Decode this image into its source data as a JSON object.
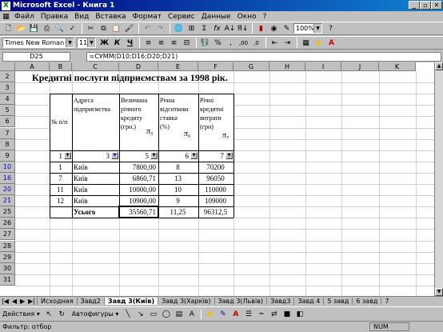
{
  "window": {
    "title": "Microsoft Excel - Книга 1",
    "minimize": "_",
    "restore": "▫",
    "close": "✕"
  },
  "menu": [
    "Файл",
    "Правка",
    "Вид",
    "Вставка",
    "Формат",
    "Сервис",
    "Данные",
    "Окно",
    "?"
  ],
  "toolbar": {
    "zoom": "100%",
    "font": "Times New Roman",
    "size": "11",
    "bold": "Ж",
    "italic": "К",
    "underline": "Ч"
  },
  "formula_bar": {
    "name_box": "D25",
    "eq": "=",
    "formula": "=СУММ(D10;D16;D20;D21)"
  },
  "columns": [
    "A",
    "B",
    "C",
    "D",
    "E",
    "F",
    "G",
    "H",
    "I",
    "J",
    "K"
  ],
  "rows": [
    "2",
    "3",
    "4",
    "5",
    "6",
    "7",
    "8",
    "9",
    "10",
    "16",
    "20",
    "21",
    "25",
    "26",
    "27",
    "28",
    "29",
    "30",
    "31"
  ],
  "sheet": {
    "title": "Кредитні послуги підприємствам за 1998 рік.",
    "headers": {
      "num": "№ п/п",
      "address": [
        "Адреса",
        "підприємства"
      ],
      "credit": [
        "Величина",
        "річного",
        "кредиту",
        "(грн.)"
      ],
      "rate": [
        "Річна",
        "відсоткова",
        "ставка",
        "(%)"
      ],
      "cost": [
        "Річні",
        "кредитні",
        "витрати",
        "(грн)"
      ],
      "pi5": "π₅",
      "pi6": "π₆",
      "pi7": "π₇"
    },
    "filter_row": [
      "1",
      "3",
      "5",
      "6",
      "7"
    ],
    "data": [
      {
        "n": "1",
        "city": "Київ",
        "credit": "7800,00",
        "rate": "8",
        "cost": "70200"
      },
      {
        "n": "7",
        "city": "Київ",
        "credit": "6860,71",
        "rate": "13",
        "cost": "96050"
      },
      {
        "n": "11",
        "city": "Київ",
        "credit": "10000,00",
        "rate": "10",
        "cost": "110000"
      },
      {
        "n": "12",
        "city": "Київ",
        "credit": "10900,00",
        "rate": "9",
        "cost": "109000"
      }
    ],
    "total": {
      "label": "Усього",
      "credit": "35560,71",
      "rate": "11,25",
      "cost": "96312,5"
    }
  },
  "tabs": [
    "Исходная",
    "Завд2",
    "Завд 3(Київ)",
    "Завд 3(Харків)",
    "Завд 3(Львів)",
    "Завд3",
    "Завд 4",
    "5 завд",
    "6 завд",
    "7"
  ],
  "active_tab": "Завд 3(Київ)",
  "drawbar": {
    "actions": "Действия ▾",
    "autoshapes": "Автофигуры ▾"
  },
  "status": {
    "left": "Фильтр: отбор",
    "num": "NUM"
  }
}
